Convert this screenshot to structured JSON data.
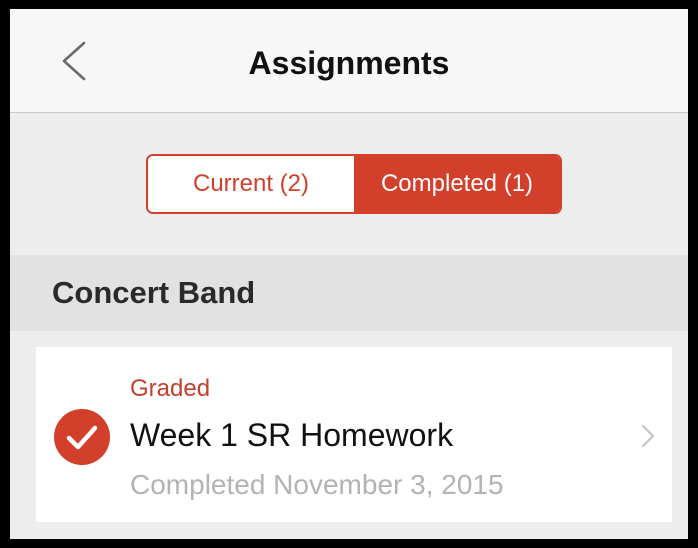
{
  "header": {
    "title": "Assignments",
    "back_icon": "chevron-left-icon"
  },
  "tabs": [
    {
      "label": "Current (2)",
      "selected": false
    },
    {
      "label": "Completed (1)",
      "selected": true
    }
  ],
  "section": {
    "title": "Concert Band"
  },
  "assignments": [
    {
      "status": "Graded",
      "title": "Week 1 SR Homework",
      "subtitle": "Completed November 3, 2015",
      "status_icon": "checkmark-circle-icon",
      "disclosure_icon": "chevron-right-icon"
    }
  ],
  "colors": {
    "accent": "#d2402c",
    "background": "#ededed",
    "navbar": "#f7f7f7",
    "section_header": "#e2e2e2",
    "secondary_text": "#b3b3b3"
  }
}
